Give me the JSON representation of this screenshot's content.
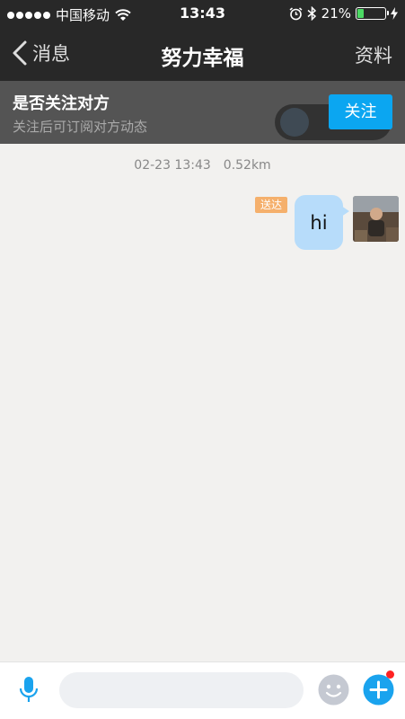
{
  "status_bar": {
    "carrier": "中国移动",
    "time": "13:43",
    "battery_percent": "21%",
    "battery_level": 0.21,
    "icons": [
      "signal-dots-icon",
      "wifi-icon",
      "alarm-icon",
      "bluetooth-icon",
      "battery-icon",
      "charging-icon"
    ]
  },
  "nav": {
    "back_label": "消息",
    "title": "努力幸福",
    "right_label": "资料"
  },
  "follow_banner": {
    "title": "是否关注对方",
    "subtitle": "关注后可订阅对方动态",
    "button_label": "关注"
  },
  "chat": {
    "timestamp": "02-23 13:43",
    "distance": "0.52km",
    "messages": [
      {
        "text": "hi",
        "status": "送达",
        "sender": "me"
      }
    ]
  },
  "input_bar": {
    "placeholder": "",
    "icons": [
      "microphone-icon",
      "emoji-icon",
      "plus-icon"
    ]
  },
  "colors": {
    "bar_bg": "#282828",
    "accent_blue": "#0ba6f1",
    "bubble_blue": "#b7dcfa",
    "delivered_orange": "#f5b06c",
    "chat_bg": "#f2f1ef"
  }
}
